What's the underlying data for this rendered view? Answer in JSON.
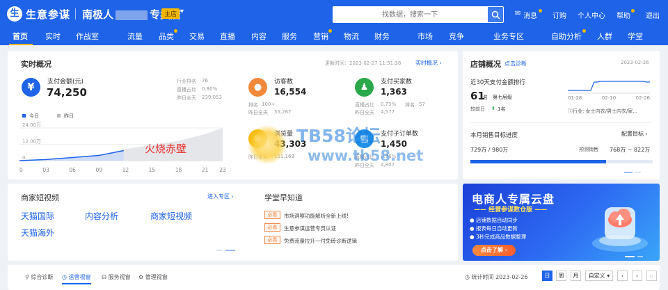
{
  "header": {
    "logo": "生",
    "brand": "生意参谋",
    "shop_prefix": "南极人",
    "shop_suffix": "专卖店",
    "shop_badge": "主店",
    "search_placeholder": "找数据，搜索一下",
    "links": [
      "消息",
      "订购",
      "个人中心",
      "帮助",
      "退出"
    ]
  },
  "nav": [
    "首页",
    "实时",
    "作战室",
    "流量",
    "品类",
    "交易",
    "直播",
    "内容",
    "服务",
    "营销",
    "物流",
    "财务",
    "市场",
    "竞争",
    "业务专区",
    "自助分析",
    "人群",
    "学堂"
  ],
  "realtime": {
    "title": "实时概况",
    "update_time": "更新时间：2023-02-27 11:51:38",
    "link": "实时概况",
    "payment": {
      "label": "支付金额(元)",
      "value": "74,250",
      "industry_rank": "行业排名",
      "industry_rank_value": "76",
      "live_share": "直播占比",
      "live_share_value": "0.80%",
      "yesterday": "昨日全天",
      "yesterday_value": "239,053"
    },
    "chart_legend_today": "今日",
    "chart_legend_yesterday": "昨日",
    "visitors": {
      "label": "访客数",
      "value": "16,554",
      "rank": "排名",
      "rank_value": "100+",
      "yesterday": "昨日全天",
      "yesterday_value": "55,267"
    },
    "buyers": {
      "label": "支付买家数",
      "value": "1,363",
      "live_share": "直播占比",
      "live_share_value": "0.73%",
      "rank": "排名",
      "rank_value": "57",
      "yesterday": "昨日全天",
      "yesterday_value": "4,577"
    },
    "views": {
      "label": "浏览量",
      "value": "43,303",
      "yesterday": "昨日全天",
      "yesterday_value": "151,169"
    },
    "orders": {
      "label": "支付子订单数",
      "value": "1,450",
      "live_share": "直播占比",
      "live_share_value": "0.76%",
      "yesterday": "昨日全天",
      "yesterday_value": "4,807"
    }
  },
  "chart_data": {
    "type": "area",
    "x": [
      "00",
      "03",
      "06",
      "09",
      "12",
      "15",
      "18",
      "21",
      "23"
    ],
    "ylim": [
      0,
      24
    ],
    "yticks": [
      "24.00万",
      "12.00万",
      "0"
    ],
    "series": [
      {
        "name": "今日",
        "x": [
          0,
          3,
          6,
          9,
          11.8
        ],
        "y": [
          0,
          0.8,
          2.3,
          3.8,
          7.4
        ]
      },
      {
        "name": "昨日",
        "x": [
          0,
          3,
          6,
          9,
          12,
          15,
          18,
          21,
          23
        ],
        "y": [
          0,
          0.8,
          2.3,
          4.5,
          8.5,
          11.5,
          14.5,
          19.5,
          24.0
        ]
      }
    ]
  },
  "store": {
    "title": "店铺概况",
    "diagnose_link": "点击诊断",
    "date": "2023-02-26",
    "rank_title": "近30天支付金额排行",
    "rank_value": "61",
    "rank_unit": "名",
    "level": "第七层级",
    "compare": "较前日",
    "change": "1名",
    "industry": "行业: 女士内衣/男士内衣/家...",
    "chart_data": {
      "type": "line",
      "x": [
        "01-28",
        "02-10",
        "02-26"
      ],
      "series": [
        {
          "y": [
            0.2,
            0.2,
            0.2,
            0.2,
            0.2,
            0.2,
            0.2,
            0.2,
            0.8,
            0.8,
            0.85,
            0.85,
            0.85,
            0.85,
            0.85,
            0.85,
            0.85,
            0.85,
            0.85,
            0.85,
            0.85,
            0.85,
            0.85,
            0.85,
            0.8,
            0.8
          ]
        }
      ]
    },
    "target_title": "本月销售目标进度",
    "target_link": "配置目标",
    "progress": "729万 / 980万",
    "progress_fraction": 0.744,
    "forecast_label": "预测销售",
    "forecast_value": "768万 ~ 822万"
  },
  "video": {
    "title": "商家短视频",
    "link": "进入专区",
    "items": [
      "天猫国际",
      "内容分析",
      "商家短视频",
      "天猫海外"
    ]
  },
  "school": {
    "title": "学堂早知道",
    "tag": "必看",
    "items": [
      "市场洞察功能解析全新上线!",
      "生意参谋运营专员认证",
      "免费流量拉升一付免砖诊断逻辑"
    ]
  },
  "banner": {
    "title": "电商人专属云盘",
    "subtitle": "—— 经营参谋数仓版 ——",
    "features": [
      "店铺数据自动同步",
      "报表每日自动更新",
      "3秒完成商品数据整理"
    ],
    "cta": "点击了解"
  },
  "bottom": {
    "tabs": [
      "综合诊断",
      "运营视窗",
      "服务视窗",
      "管理视窗"
    ],
    "stat_time": "统计时间 2023-02-26",
    "periods": [
      "日",
      "周",
      "月",
      "自定义"
    ]
  },
  "watermark": {
    "stamp": "火烧赤壁",
    "site": "TB58论坛",
    "url": "www.tb58.net"
  },
  "colors": {
    "primary": "#1e63e8",
    "accent": "#f5b800",
    "visitors_icon": "#f08a3a",
    "buyers_icon": "#2aa84a"
  }
}
